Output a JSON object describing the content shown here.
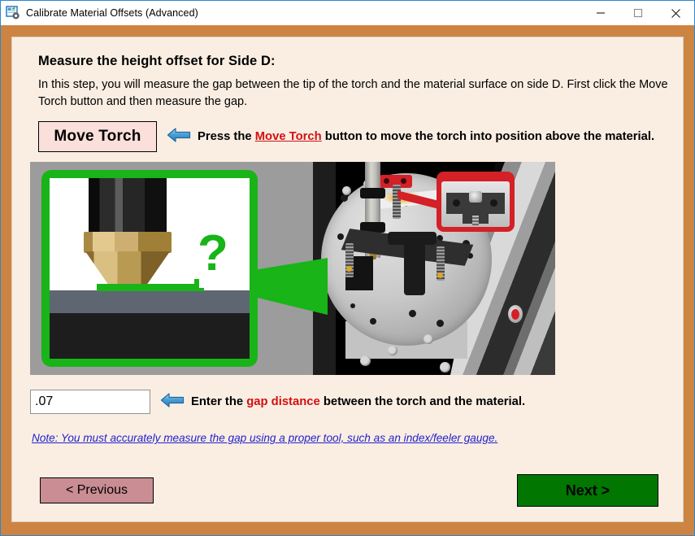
{
  "window": {
    "title": "Calibrate Material Offsets (Advanced)",
    "icon": "app-form-gear-icon",
    "controls": {
      "minimize": "minimize-icon",
      "maximize": "maximize-icon",
      "close": "close-icon"
    },
    "frame_color": "#cd8442",
    "panel_color": "#faeee3",
    "border_color": "#2b87d0"
  },
  "content": {
    "heading": "Measure the height offset for Side D:",
    "intro": "In this step, you will measure the gap between the tip of the torch and the material surface on side D. First click the Move Torch button and then measure the gap.",
    "move_torch_button": "Move Torch",
    "move_torch_instruction": {
      "prefix": "Press the ",
      "emphasis": "Move Torch",
      "suffix": " button to move the torch into position above the material."
    },
    "gap_input": {
      "value": ".07",
      "placeholder": ""
    },
    "gap_instruction": {
      "prefix": "Enter the ",
      "emphasis": "gap distance",
      "suffix": " between the torch and the material."
    },
    "note": "Note: You must accurately measure the gap using a proper tool, such as an index/feeler gauge.",
    "arrow_icon": "arrow-left-icon"
  },
  "illustration": {
    "zoom_callout_marker": "?",
    "zoom_border_color": "#18b418",
    "red_callout_color": "#d42027",
    "stage_background": "#9c9c9c"
  },
  "footer": {
    "previous_label": "< Previous",
    "next_label": "Next >",
    "previous_color": "#c98d93",
    "next_color": "#017701"
  }
}
